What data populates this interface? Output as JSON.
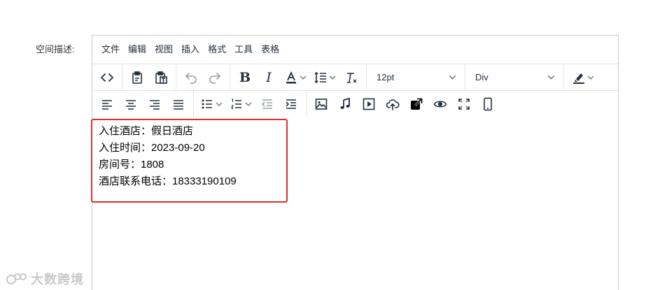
{
  "form": {
    "field_label": "空间描述:"
  },
  "menubar": {
    "items": [
      "文件",
      "编辑",
      "视图",
      "插入",
      "格式",
      "工具",
      "表格"
    ]
  },
  "toolbar": {
    "font_size": "12pt",
    "block_format": "Div"
  },
  "content": {
    "lines": [
      "入住酒店：假日酒店",
      "入住时间：2023-09-20",
      "房间号：1808",
      "酒店联系电话：18333190109"
    ]
  },
  "watermark": {
    "text": "大数跨境"
  },
  "colors": {
    "highlight_border": "#d9312b",
    "editor_border": "#cccccc",
    "icon": "#222f3e"
  }
}
